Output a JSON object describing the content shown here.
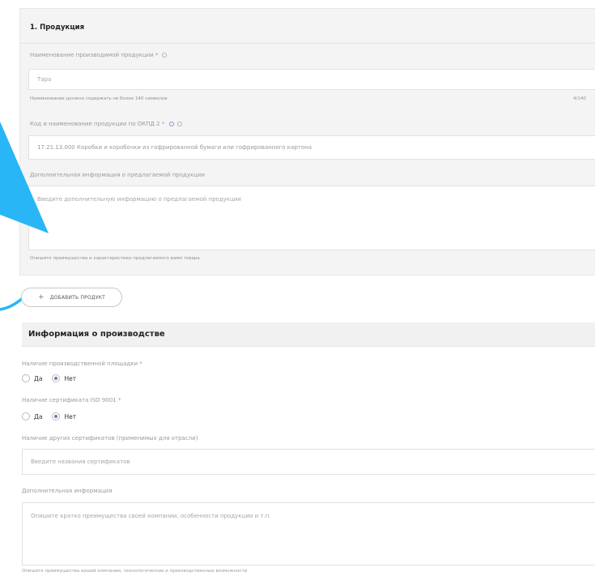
{
  "product_section": {
    "title": "1. Продукция",
    "name_label": "Наименование производимой продукции *",
    "name_value": "Тара",
    "name_hint": "Наименование должно содержать не более 140 символов",
    "name_counter": "4/140",
    "okpd_label": "Код и наименование продукции по ОКПД 2 *",
    "okpd_value": "17.21.13.000 Коробки и коробочки из гофрированной бумаги или гофрированного картона",
    "extra_label": "Дополнительная информация о предлагаемой продукции",
    "extra_placeholder": "Введите дополнительную информацию о предлагаемой продукции",
    "extra_hint": "Опишите преимущества и характеристики предлагаемого вами товара"
  },
  "add_product_button": "ДОБАВИТЬ ПРОДУКТ",
  "production_section": {
    "title": "Информация о производстве",
    "facilities_label": "Наличие производственной площадки *",
    "iso_label": "Наличие сертификата ISO 9001 *",
    "option_yes": "Да",
    "option_no": "Нет",
    "facilities_selected": "Нет",
    "iso_selected": "Нет",
    "other_certs_label": "Наличие других сертификатов (применимых для отрасли)",
    "other_certs_placeholder": "Введите названия сертификатов",
    "extra_info_label": "Дополнительная информация",
    "extra_info_placeholder": "Опишите кратко преимущества своей компании, особенности продукции и т.п.",
    "bottom_hint": "Опишите преимущества вашей компании, технологические и производственные возможности"
  },
  "colors": {
    "callout_arrow": "#29b6f6",
    "radio_checked": "#6b7fa6"
  }
}
